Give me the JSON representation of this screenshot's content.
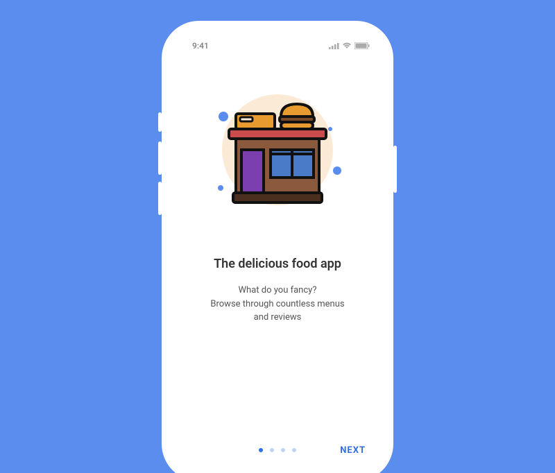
{
  "status": {
    "time": "9:41"
  },
  "onboarding": {
    "title": "The delicious food app",
    "subtitle": "What do you fancy?\nBrowse through countless menus\nand reviews",
    "next_label": "NEXT",
    "page_count": 4,
    "active_page": 0
  },
  "colors": {
    "background": "#5B8DEF",
    "accent": "#2F6FE4"
  }
}
